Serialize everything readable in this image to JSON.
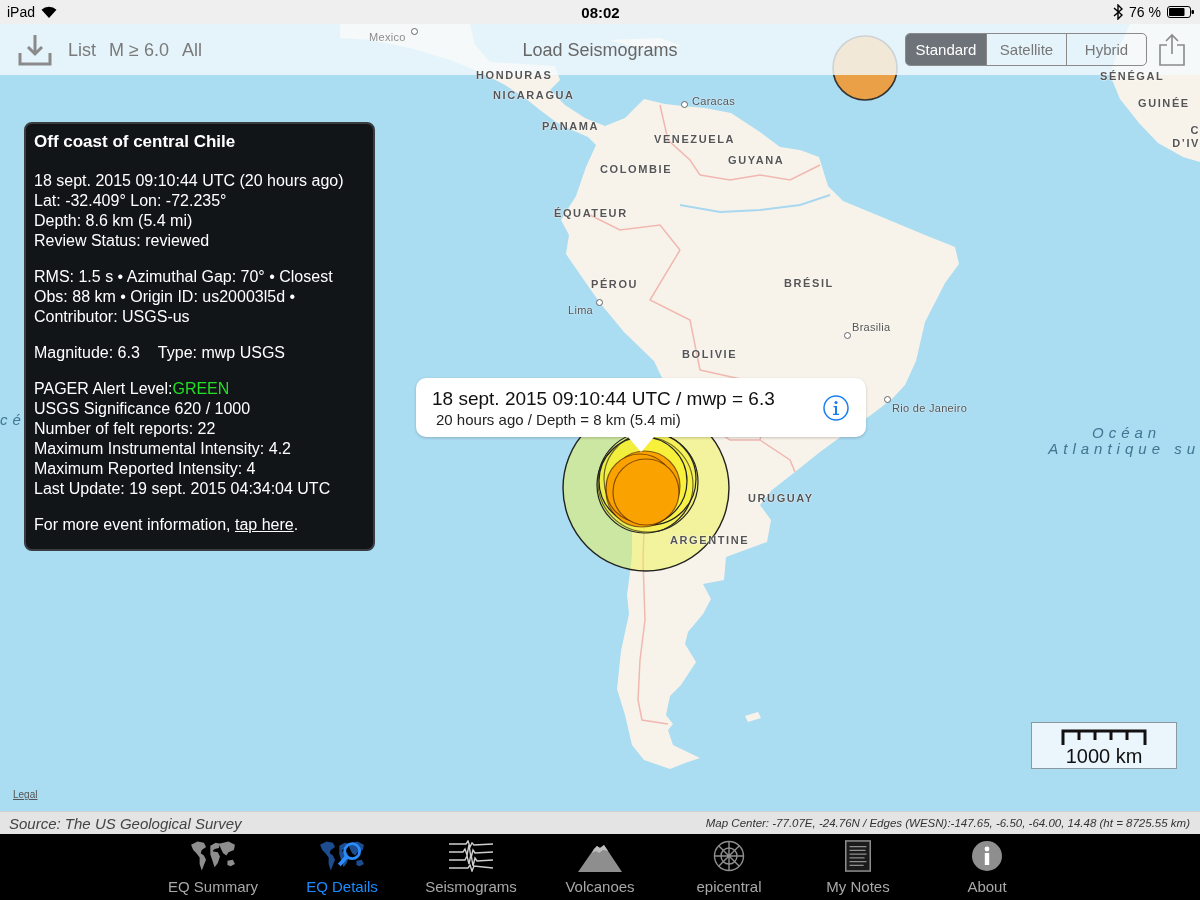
{
  "status_bar": {
    "device": "iPad",
    "time": "08:02",
    "battery": "76 %"
  },
  "toolbar": {
    "list_button": "List",
    "magnitude_filter": "M ≥ 6.0",
    "period_filter": "All",
    "load_button": "Load Seismograms",
    "map_types": [
      {
        "label": "Standard",
        "selected": true
      },
      {
        "label": "Satellite",
        "selected": false
      },
      {
        "label": "Hybrid",
        "selected": false
      }
    ]
  },
  "map_labels": [
    {
      "text": "Mexico",
      "kind": "city"
    },
    {
      "text": "HONDURAS",
      "kind": "country"
    },
    {
      "text": "SÉNÉGAL",
      "kind": "country"
    },
    {
      "text": "NICARAGUA",
      "kind": "country"
    },
    {
      "text": "Caracas",
      "kind": "city"
    },
    {
      "text": "GUINÉE",
      "kind": "country"
    },
    {
      "text": "PANAMA",
      "kind": "country"
    },
    {
      "text": "C",
      "kind": "country"
    },
    {
      "text": "VENEZUELA",
      "kind": "country"
    },
    {
      "text": "D’IV",
      "kind": "country"
    },
    {
      "text": "GUYANA",
      "kind": "country"
    },
    {
      "text": "COLOMBIE",
      "kind": "country"
    },
    {
      "text": "ÉQUATEUR",
      "kind": "country"
    },
    {
      "text": "PÉROU",
      "kind": "country"
    },
    {
      "text": "BRÉSIL",
      "kind": "country"
    },
    {
      "text": "Lima",
      "kind": "city"
    },
    {
      "text": "Brasilia",
      "kind": "city"
    },
    {
      "text": "BOLIVIE",
      "kind": "country"
    },
    {
      "text": "Rio de Janeiro",
      "kind": "city"
    },
    {
      "text": "cé",
      "kind": "ocean"
    },
    {
      "text": "Océan",
      "kind": "ocean"
    },
    {
      "text": "Atlantique su",
      "kind": "ocean"
    },
    {
      "text": "URUGUAY",
      "kind": "country"
    },
    {
      "text": "ARGENTINE",
      "kind": "country"
    }
  ],
  "event_panel": {
    "title": "Off coast of central Chile",
    "time_lines": [
      "18 sept. 2015 09:10:44 UTC (20 hours ago)",
      "Lat: -32.409° Lon: -72.235°",
      "Depth: 8.6 km (5.4 mi)",
      "Review Status: reviewed"
    ],
    "quality": "RMS: 1.5 s • Azimuthal Gap: 70° • Closest Obs: 88 km • Origin ID: us20003l5d • Contributor: USGS-us",
    "magnitude": "Magnitude: 6.3",
    "magnitude_type": "Type: mwp USGS",
    "pager": {
      "label": "PAGER Alert Level:",
      "value": "GREEN",
      "color": "#22dd22"
    },
    "impact_lines": [
      "USGS Significance 620 / 1000",
      "Number of felt reports: 22",
      "Maximum Instrumental Intensity: 4.2",
      "Maximum Reported Intensity: 4",
      "Last Update: 19 sept. 2015 04:34:04 UTC"
    ],
    "more_info": {
      "text": "For more event information,",
      "link": "tap here",
      "end": "."
    }
  },
  "callout": {
    "title": "18 sept. 2015 09:10:44 UTC / mwp = 6.3",
    "subtitle": "20 hours ago / Depth = 8 km (5.4 mi)"
  },
  "scale": "1000 km",
  "legal_link": "Legal",
  "source_bar": {
    "source": "Source: The US Geological Survey",
    "map_info": "Map Center: -77.07E, -24.76N / Edges (WESN):-147.65, -6.50, -64.00, 14.48 (ht = 8725.55 km)"
  },
  "tabs": [
    {
      "label": "EQ Summary",
      "kind": "world",
      "selected": false
    },
    {
      "label": "EQ Details",
      "kind": "details",
      "selected": true
    },
    {
      "label": "Seismograms",
      "kind": "seismograms",
      "selected": false
    },
    {
      "label": "Volcanoes",
      "kind": "volcanoes",
      "selected": false
    },
    {
      "label": "epicentral",
      "kind": "epicentral",
      "selected": false
    },
    {
      "label": "My Notes",
      "kind": "notes",
      "selected": false
    },
    {
      "label": "About",
      "kind": "about",
      "selected": false
    }
  ]
}
